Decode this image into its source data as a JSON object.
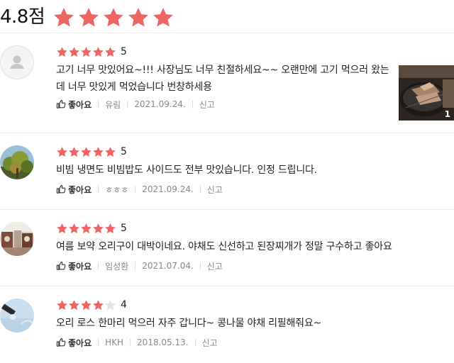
{
  "summary": {
    "score": "4.8점",
    "rating": 4.8
  },
  "reviews": [
    {
      "rating": 5,
      "rating_label": "5",
      "text_lines": [
        "고기 너무 맛있어요~!!! 사장님도 너무 친절하세요~~ 오랜만에 고기 먹으러 왔는",
        "데 너무 맛있게 먹었습니다 번창하세용"
      ],
      "like_label": "좋아요",
      "author": "유림",
      "date": "2021.09.24.",
      "report_label": "신고",
      "photo_count": "1"
    },
    {
      "rating": 5,
      "rating_label": "5",
      "text_lines": [
        "비빔 냉면도 비빔밥도 사이드도 전부 맛있습니다. 인정 드립니다."
      ],
      "like_label": "좋아요",
      "author": "ㅎㅎㅎ",
      "date": "2021.09.24.",
      "report_label": "신고"
    },
    {
      "rating": 5,
      "rating_label": "5",
      "text_lines": [
        "여름 보약 오리구이 대박이네요. 야채도 신선하고 된장찌개가 정말 구수하고 좋아요"
      ],
      "like_label": "좋아요",
      "author": "임성환",
      "date": "2021.07.04.",
      "report_label": "신고"
    },
    {
      "rating": 4,
      "rating_label": "4",
      "text_lines": [
        "오리 로스 한마리 먹으러 자주 갑니다~ 콩나물 야채 리필해줘요~"
      ],
      "like_label": "좋아요",
      "author": "HKH",
      "date": "2018.05.13.",
      "report_label": "신고"
    }
  ],
  "colors": {
    "star_on": "#ee6664",
    "star_off": "#e4e4e4",
    "meta": "#888888",
    "divider": "#ececec"
  },
  "icons": [
    "star-icon",
    "thumbs-up-icon",
    "default-avatar-icon"
  ]
}
